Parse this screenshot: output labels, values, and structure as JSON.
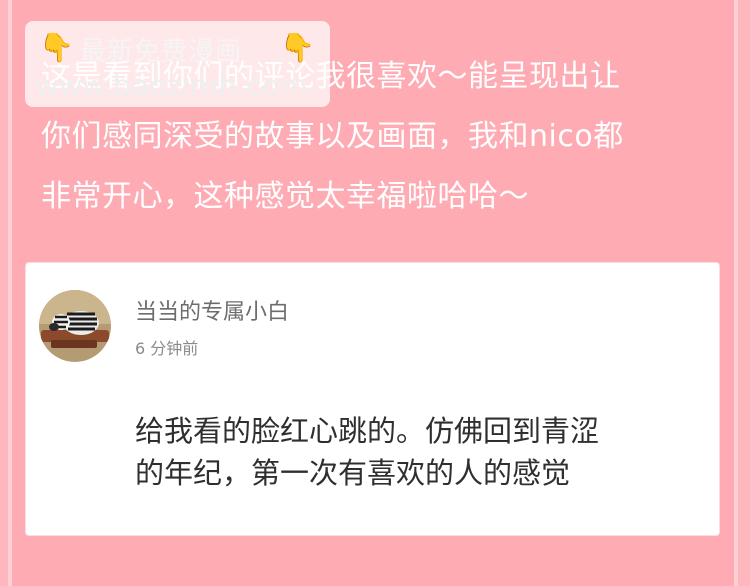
{
  "watermark": {
    "title": "最新免费漫画",
    "url": "www.baozimh.com",
    "left_icon": "pointing-down-icon",
    "right_icon": "pointing-down-icon"
  },
  "post": {
    "text": "这是看到你们的评论我很喜欢～能呈现出让\n你们感同深受的故事以及画面，我和nico都\n非常开心，这种感觉太幸福啦哈哈～"
  },
  "comment": {
    "username": "当当的专属小白",
    "time": "6 分钟前",
    "text": "给我看的脸红心跳的。仿佛回到青涩\n的年纪，第一次有喜欢的人的感觉"
  },
  "colors": {
    "background": "#ffabb4",
    "card": "#ffffff",
    "text_white": "#ffffff",
    "watermark_icon": "#f7a21c"
  }
}
